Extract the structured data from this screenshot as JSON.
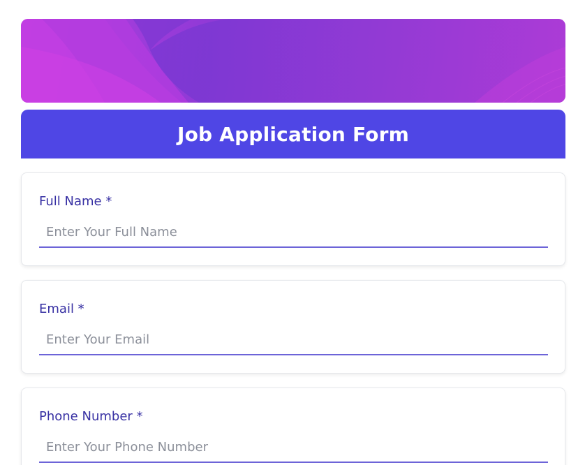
{
  "form": {
    "title": "Job Application Form",
    "fields": [
      {
        "label": "Full Name *",
        "placeholder": "Enter Your Full Name",
        "value": ""
      },
      {
        "label": "Email *",
        "placeholder": "Enter Your Email",
        "value": ""
      },
      {
        "label": "Phone Number *",
        "placeholder": "Enter Your Phone Number",
        "value": ""
      }
    ]
  },
  "colors": {
    "accent": "#4f46e5",
    "label": "#3730a3",
    "underline": "#6d64d8",
    "banner_primary": "#a23cd6"
  }
}
